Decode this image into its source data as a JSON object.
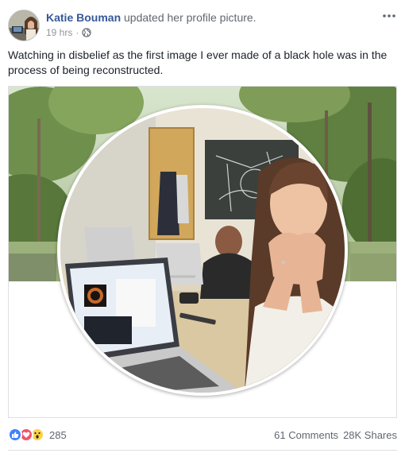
{
  "header": {
    "author": "Katie Bouman",
    "action": "updated her profile picture.",
    "time": "19 hrs",
    "separator": "·",
    "privacy_icon": "globe-icon",
    "more_icon": "more-options-icon"
  },
  "post": {
    "caption": "Watching in disbelief as the first image I ever made of a black hole was in the process of being reconstructed."
  },
  "footer": {
    "reaction_icons": [
      "like-reaction-icon",
      "love-reaction-icon",
      "wow-reaction-icon"
    ],
    "reaction_count": "285",
    "comments": "61 Comments",
    "shares": "28K Shares"
  },
  "colors": {
    "link": "#365899",
    "meta": "#90949c",
    "text": "#1d2129",
    "like": "#4080ff",
    "love": "#f25268",
    "wow": "#fcd14c"
  }
}
